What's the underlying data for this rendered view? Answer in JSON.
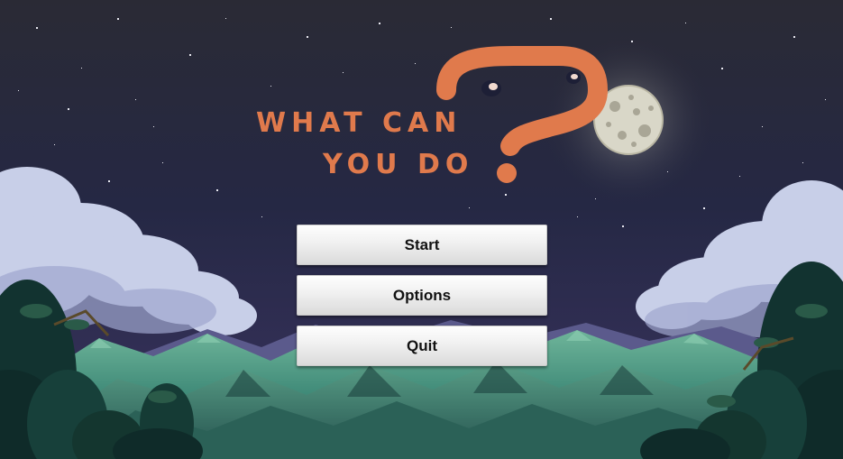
{
  "title": {
    "line1": "WHAT CAN",
    "line2": "YOU DO"
  },
  "menu": {
    "items": [
      {
        "id": "start",
        "label": "Start"
      },
      {
        "id": "options",
        "label": "Options"
      },
      {
        "id": "quit",
        "label": "Quit"
      }
    ]
  },
  "colors": {
    "logo_accent": "#e07a4c",
    "sky": "#1d1f36",
    "button_face": "#ececec",
    "button_text": "#111111"
  },
  "icons": {
    "logo_mark": "question-mark-icon",
    "moon": "moon-icon"
  }
}
